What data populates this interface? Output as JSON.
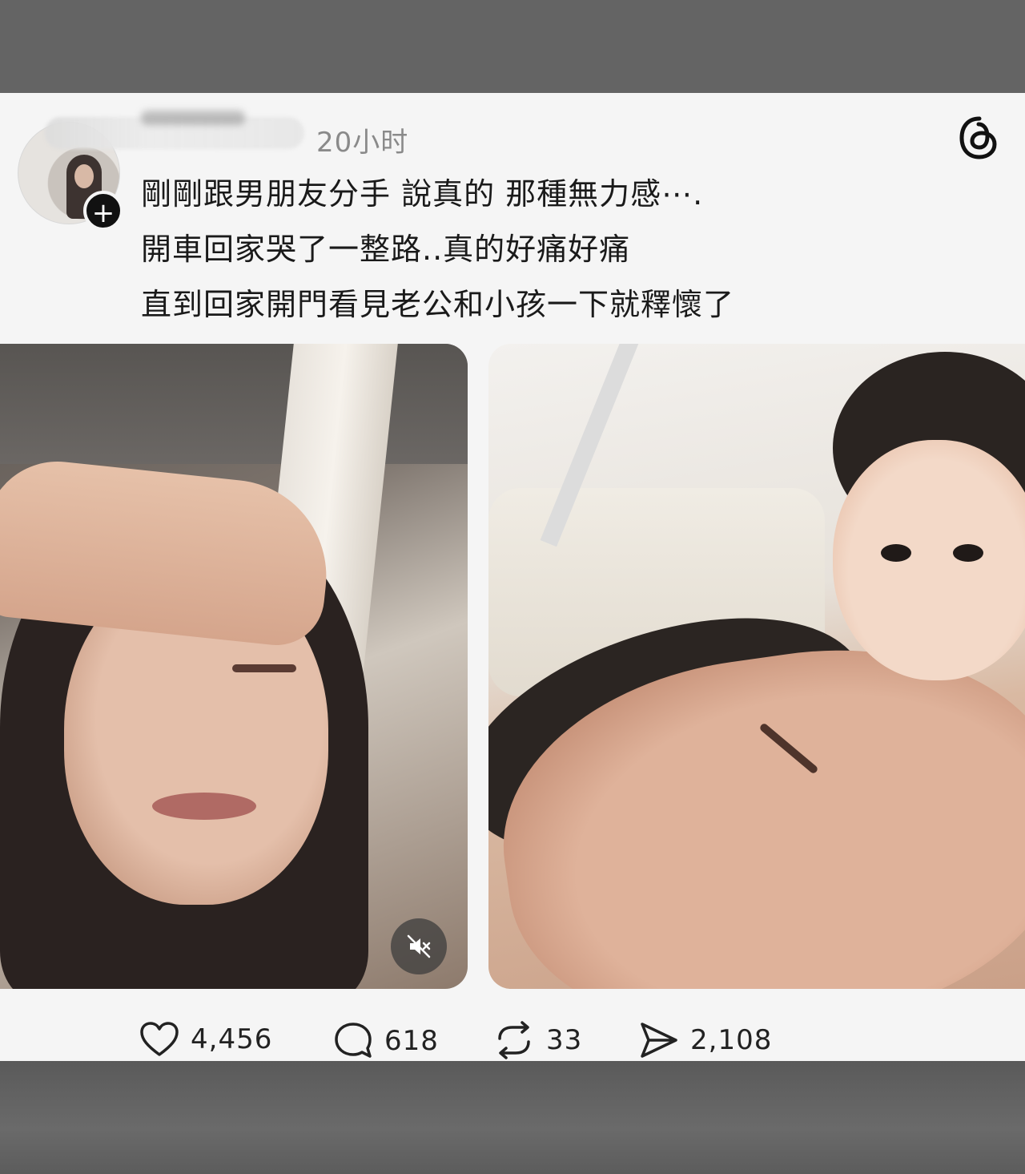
{
  "post": {
    "time": "20小时",
    "follow_symbol": "+",
    "caption_lines": [
      "剛剛跟男朋友分手 說真的 那種無力感⋯.",
      "開車回家哭了一整路..真的好痛好痛",
      "直到回家開門看見老公和小孩一下就釋懷了"
    ]
  },
  "actions": {
    "likes": "4,456",
    "comments": "618",
    "reposts": "33",
    "shares": "2,108"
  },
  "icons": [
    "threads-icon",
    "mute-icon",
    "heart-icon",
    "comment-icon",
    "repost-icon",
    "share-icon"
  ]
}
